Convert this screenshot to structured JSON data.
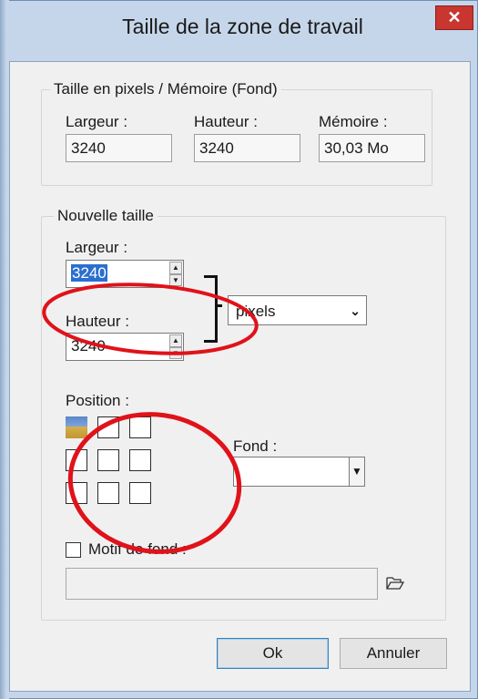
{
  "window": {
    "title": "Taille de la zone de travail",
    "close_glyph": "✕"
  },
  "current": {
    "legend": "Taille en pixels / Mémoire (Fond)",
    "width_label": "Largeur :",
    "width_value": "3240",
    "height_label": "Hauteur :",
    "height_value": "3240",
    "memory_label": "Mémoire :",
    "memory_value": "30,03 Mo"
  },
  "new_size": {
    "legend": "Nouvelle taille",
    "width_label": "Largeur :",
    "width_value": "3240",
    "height_label": "Hauteur :",
    "height_value": "3240",
    "unit_selected": "pixels",
    "position_label": "Position :",
    "background_label": "Fond :",
    "background_value": "",
    "pattern_label": "Motif de fond :",
    "pattern_checked": false,
    "pattern_value": "",
    "anchor_selected": "top-left"
  },
  "buttons": {
    "ok_label": "Ok",
    "cancel_label": "Annuler"
  },
  "icons": {
    "close": "close-icon",
    "spin_up": "spin-up-icon",
    "spin_down": "spin-down-icon",
    "dropdown": "chevron-down-icon",
    "folder": "open-folder-icon",
    "link_bracket": "link-bracket-icon"
  },
  "colors": {
    "selection": "#2a6fd0",
    "close_button": "#c8362f",
    "annotation": "#e0121a",
    "frame": "#c6d6ea"
  }
}
